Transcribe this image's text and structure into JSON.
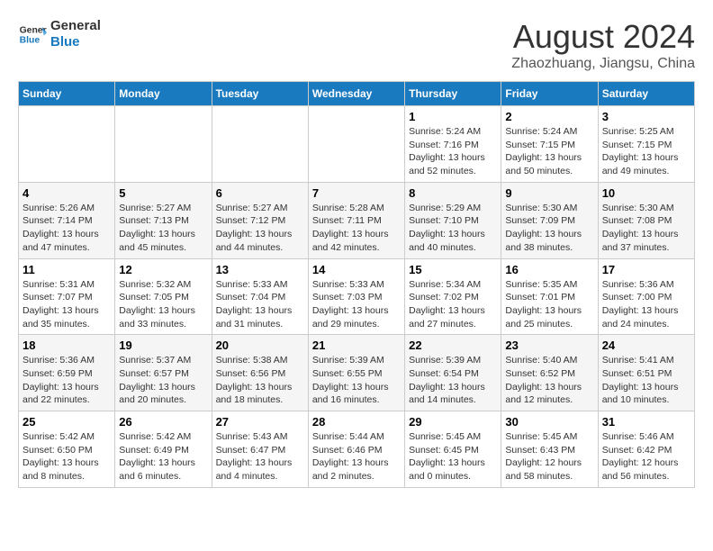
{
  "header": {
    "logo_line1": "General",
    "logo_line2": "Blue",
    "main_title": "August 2024",
    "subtitle": "Zhaozhuang, Jiangsu, China"
  },
  "weekdays": [
    "Sunday",
    "Monday",
    "Tuesday",
    "Wednesday",
    "Thursday",
    "Friday",
    "Saturday"
  ],
  "weeks": [
    [
      {
        "day": "",
        "info": ""
      },
      {
        "day": "",
        "info": ""
      },
      {
        "day": "",
        "info": ""
      },
      {
        "day": "",
        "info": ""
      },
      {
        "day": "1",
        "info": "Sunrise: 5:24 AM\nSunset: 7:16 PM\nDaylight: 13 hours\nand 52 minutes."
      },
      {
        "day": "2",
        "info": "Sunrise: 5:24 AM\nSunset: 7:15 PM\nDaylight: 13 hours\nand 50 minutes."
      },
      {
        "day": "3",
        "info": "Sunrise: 5:25 AM\nSunset: 7:15 PM\nDaylight: 13 hours\nand 49 minutes."
      }
    ],
    [
      {
        "day": "4",
        "info": "Sunrise: 5:26 AM\nSunset: 7:14 PM\nDaylight: 13 hours\nand 47 minutes."
      },
      {
        "day": "5",
        "info": "Sunrise: 5:27 AM\nSunset: 7:13 PM\nDaylight: 13 hours\nand 45 minutes."
      },
      {
        "day": "6",
        "info": "Sunrise: 5:27 AM\nSunset: 7:12 PM\nDaylight: 13 hours\nand 44 minutes."
      },
      {
        "day": "7",
        "info": "Sunrise: 5:28 AM\nSunset: 7:11 PM\nDaylight: 13 hours\nand 42 minutes."
      },
      {
        "day": "8",
        "info": "Sunrise: 5:29 AM\nSunset: 7:10 PM\nDaylight: 13 hours\nand 40 minutes."
      },
      {
        "day": "9",
        "info": "Sunrise: 5:30 AM\nSunset: 7:09 PM\nDaylight: 13 hours\nand 38 minutes."
      },
      {
        "day": "10",
        "info": "Sunrise: 5:30 AM\nSunset: 7:08 PM\nDaylight: 13 hours\nand 37 minutes."
      }
    ],
    [
      {
        "day": "11",
        "info": "Sunrise: 5:31 AM\nSunset: 7:07 PM\nDaylight: 13 hours\nand 35 minutes."
      },
      {
        "day": "12",
        "info": "Sunrise: 5:32 AM\nSunset: 7:05 PM\nDaylight: 13 hours\nand 33 minutes."
      },
      {
        "day": "13",
        "info": "Sunrise: 5:33 AM\nSunset: 7:04 PM\nDaylight: 13 hours\nand 31 minutes."
      },
      {
        "day": "14",
        "info": "Sunrise: 5:33 AM\nSunset: 7:03 PM\nDaylight: 13 hours\nand 29 minutes."
      },
      {
        "day": "15",
        "info": "Sunrise: 5:34 AM\nSunset: 7:02 PM\nDaylight: 13 hours\nand 27 minutes."
      },
      {
        "day": "16",
        "info": "Sunrise: 5:35 AM\nSunset: 7:01 PM\nDaylight: 13 hours\nand 25 minutes."
      },
      {
        "day": "17",
        "info": "Sunrise: 5:36 AM\nSunset: 7:00 PM\nDaylight: 13 hours\nand 24 minutes."
      }
    ],
    [
      {
        "day": "18",
        "info": "Sunrise: 5:36 AM\nSunset: 6:59 PM\nDaylight: 13 hours\nand 22 minutes."
      },
      {
        "day": "19",
        "info": "Sunrise: 5:37 AM\nSunset: 6:57 PM\nDaylight: 13 hours\nand 20 minutes."
      },
      {
        "day": "20",
        "info": "Sunrise: 5:38 AM\nSunset: 6:56 PM\nDaylight: 13 hours\nand 18 minutes."
      },
      {
        "day": "21",
        "info": "Sunrise: 5:39 AM\nSunset: 6:55 PM\nDaylight: 13 hours\nand 16 minutes."
      },
      {
        "day": "22",
        "info": "Sunrise: 5:39 AM\nSunset: 6:54 PM\nDaylight: 13 hours\nand 14 minutes."
      },
      {
        "day": "23",
        "info": "Sunrise: 5:40 AM\nSunset: 6:52 PM\nDaylight: 13 hours\nand 12 minutes."
      },
      {
        "day": "24",
        "info": "Sunrise: 5:41 AM\nSunset: 6:51 PM\nDaylight: 13 hours\nand 10 minutes."
      }
    ],
    [
      {
        "day": "25",
        "info": "Sunrise: 5:42 AM\nSunset: 6:50 PM\nDaylight: 13 hours\nand 8 minutes."
      },
      {
        "day": "26",
        "info": "Sunrise: 5:42 AM\nSunset: 6:49 PM\nDaylight: 13 hours\nand 6 minutes."
      },
      {
        "day": "27",
        "info": "Sunrise: 5:43 AM\nSunset: 6:47 PM\nDaylight: 13 hours\nand 4 minutes."
      },
      {
        "day": "28",
        "info": "Sunrise: 5:44 AM\nSunset: 6:46 PM\nDaylight: 13 hours\nand 2 minutes."
      },
      {
        "day": "29",
        "info": "Sunrise: 5:45 AM\nSunset: 6:45 PM\nDaylight: 13 hours\nand 0 minutes."
      },
      {
        "day": "30",
        "info": "Sunrise: 5:45 AM\nSunset: 6:43 PM\nDaylight: 12 hours\nand 58 minutes."
      },
      {
        "day": "31",
        "info": "Sunrise: 5:46 AM\nSunset: 6:42 PM\nDaylight: 12 hours\nand 56 minutes."
      }
    ]
  ]
}
